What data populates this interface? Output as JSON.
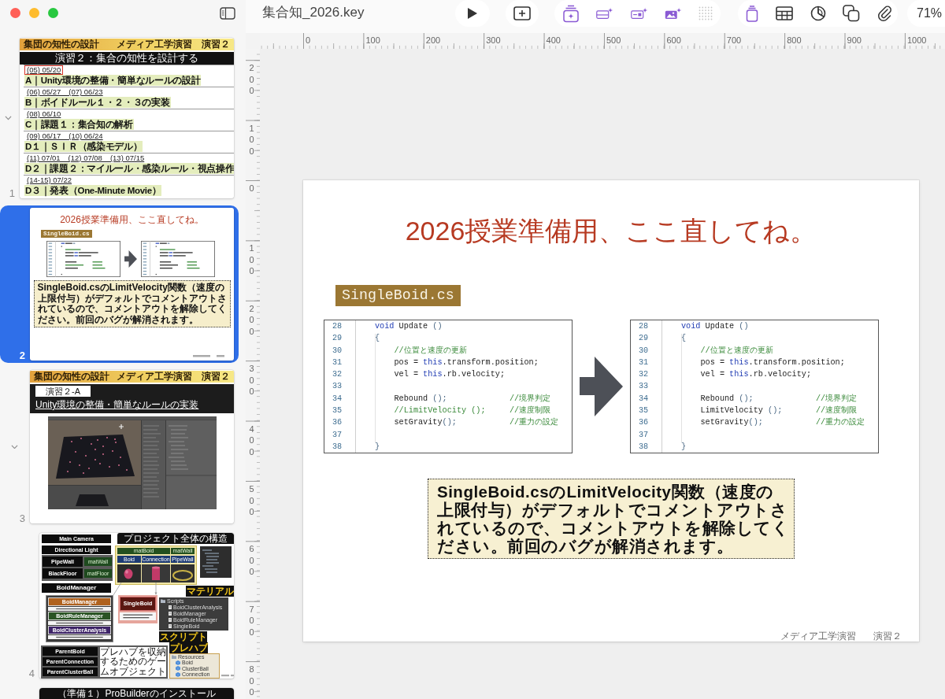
{
  "window": {
    "title": "集合知_2026.key"
  },
  "toolbar": {
    "zoom": "71%"
  },
  "navigator": {
    "slides": [
      {
        "number": "1",
        "kind": "agenda",
        "selected": false,
        "expanded": true,
        "header": {
          "left": "集団の知性の設計",
          "right": "メディア工学演習　演習２"
        },
        "title": "演習２：集合の知性を設計する",
        "units": [
          {
            "dates": "(05) 05/20",
            "marked": true,
            "title": "A｜Unity環境の整備・簡単なルールの設計"
          },
          {
            "dates": "(06) 05/27　(07) 06/23",
            "marked": false,
            "title": "B｜ボイドルール１・２・３の実装"
          },
          {
            "dates": "(08) 06/10",
            "marked": false,
            "title": "C｜課題１：集合知の解析"
          },
          {
            "dates": "(09) 06/17　(10) 06/24",
            "marked": false,
            "title": "D１｜ＳＩＲ（感染モデル）"
          },
          {
            "dates": "(11) 07/01　(12) 07/08　(13) 07/15",
            "marked": false,
            "title": "D２｜課題２：マイルール・感染ルール・視点操作"
          },
          {
            "dates": "(14-15) 07/22",
            "marked": false,
            "title": "D３｜発表（One-Minute Movie）"
          }
        ],
        "children": [
          {
            "number": "2",
            "kind": "code_fix",
            "selected": true,
            "title": "2026授業準備用、ここ直してね。",
            "file_label": "SingleBoid.cs",
            "note": "SingleBoid.csのLimitVelocity関数（速度の上限付与）がデフォルトでコメントアウトされているので、コメントアウトを解除してください。前回のバグが解消されます。"
          },
          {
            "number": "3",
            "kind": "section",
            "selected": false,
            "expanded": true,
            "header": {
              "left": "集団の知性の設計",
              "right": "メディア工学演習　演習２"
            },
            "label": "演習２-A",
            "title": "Unity環境の整備・簡単なルールの実装",
            "children": [
              {
                "number": "4",
                "kind": "diagram",
                "selected": false,
                "title": "プロジェクト全体の構造",
                "scene_objects": [
                  "Main Camera",
                  "Directional Light"
                ],
                "walls": [
                  {
                    "object": "PipeWall",
                    "material": "matWall"
                  },
                  {
                    "object": "BlackFloor",
                    "material": "matFloor"
                  }
                ],
                "manager": "BoidManager",
                "materials": {
                  "names": [
                    "matBoid",
                    "matWall"
                  ],
                  "prefabs": [
                    "Boid",
                    "Connection",
                    "PipeWall"
                  ],
                  "label": "マテリアル"
                },
                "classes": [
                  {
                    "name": "BoidManager",
                    "color": "#b0621e"
                  },
                  {
                    "name": "BoidRuleManager",
                    "color": "#2a5424"
                  },
                  {
                    "name": "BoidClusterAnalysis",
                    "color": "#3e2468"
                  }
                ],
                "single_class": "SingleBoid",
                "scripts": {
                  "folder": "Scripts",
                  "files": [
                    "BoidClusterAnalysis",
                    "BoidManager",
                    "BoidRuleManager",
                    "SingleBoid"
                  ],
                  "label": "スクリプト"
                },
                "prefabs": {
                  "label": "プレハブ",
                  "folder": "Resources",
                  "items": [
                    "Boid",
                    "ClusterBall",
                    "Connection"
                  ]
                },
                "parents": [
                  "ParentBoid",
                  "ParentConnection",
                  "ParentClusterBall"
                ],
                "parents_note": "プレハブを収納するためのゲームオブジェクト"
              },
              {
                "kind": "title_bar",
                "selected": false,
                "title": "（準備１）ProBuilderのインストール"
              }
            ]
          }
        ]
      }
    ]
  },
  "rulers": {
    "horizontal": [
      "0",
      "100",
      "200",
      "300",
      "400",
      "500",
      "600",
      "700",
      "800",
      "900",
      "1000"
    ],
    "vertical": [
      "200",
      "100",
      "0",
      "100",
      "200",
      "300",
      "400",
      "500",
      "600",
      "700",
      "800"
    ]
  },
  "slide": {
    "title": "2026授業準備用、ここ直してね。",
    "file_label": "SingleBoid.cs",
    "code_before": [
      {
        "number": "28",
        "tokens": [
          {
            "kind": "keyword",
            "text": "    void"
          },
          {
            "kind": "plain",
            "text": " Update "
          },
          {
            "kind": "punct",
            "text": "()"
          }
        ]
      },
      {
        "number": "29",
        "tokens": [
          {
            "kind": "punct",
            "text": "    {"
          }
        ]
      },
      {
        "number": "30",
        "tokens": [
          {
            "kind": "comment",
            "text": "        //位置と速度の更新"
          }
        ]
      },
      {
        "number": "31",
        "tokens": [
          {
            "kind": "plain",
            "text": "        pos = "
          },
          {
            "kind": "keyword",
            "text": "this"
          },
          {
            "kind": "plain",
            "text": ".transform.position;"
          }
        ]
      },
      {
        "number": "32",
        "tokens": [
          {
            "kind": "plain",
            "text": "        vel = "
          },
          {
            "kind": "keyword",
            "text": "this"
          },
          {
            "kind": "plain",
            "text": ".rb.velocity;"
          }
        ]
      },
      {
        "number": "33"
      },
      {
        "number": "34",
        "tokens": [
          {
            "kind": "plain",
            "text": "        Rebound "
          },
          {
            "kind": "punct",
            "text": "();"
          }
        ],
        "comment": "//境界判定"
      },
      {
        "number": "35",
        "tokens": [
          {
            "kind": "comment",
            "text": "        //LimitVelocity ();"
          }
        ],
        "comment": "//速度制限"
      },
      {
        "number": "36",
        "tokens": [
          {
            "kind": "plain",
            "text": "        setGravity"
          },
          {
            "kind": "punct",
            "text": "();"
          }
        ],
        "comment": "//重力の設定"
      },
      {
        "number": "37"
      },
      {
        "number": "38",
        "tokens": [
          {
            "kind": "punct",
            "text": "    }"
          }
        ]
      }
    ],
    "code_after": [
      {
        "number": "28",
        "tokens": [
          {
            "kind": "keyword",
            "text": "    void"
          },
          {
            "kind": "plain",
            "text": " Update "
          },
          {
            "kind": "punct",
            "text": "()"
          }
        ]
      },
      {
        "number": "29",
        "tokens": [
          {
            "kind": "punct",
            "text": "    {"
          }
        ]
      },
      {
        "number": "30",
        "tokens": [
          {
            "kind": "comment",
            "text": "        //位置と速度の更新"
          }
        ]
      },
      {
        "number": "31",
        "tokens": [
          {
            "kind": "plain",
            "text": "        pos = "
          },
          {
            "kind": "keyword",
            "text": "this"
          },
          {
            "kind": "plain",
            "text": ".transform.position;"
          }
        ]
      },
      {
        "number": "32",
        "tokens": [
          {
            "kind": "plain",
            "text": "        vel = "
          },
          {
            "kind": "keyword",
            "text": "this"
          },
          {
            "kind": "plain",
            "text": ".rb.velocity;"
          }
        ]
      },
      {
        "number": "33"
      },
      {
        "number": "34",
        "tokens": [
          {
            "kind": "plain",
            "text": "        Rebound "
          },
          {
            "kind": "punct",
            "text": "();"
          }
        ],
        "comment": "//境界判定"
      },
      {
        "number": "35",
        "tokens": [
          {
            "kind": "plain",
            "text": "        LimitVelocity "
          },
          {
            "kind": "punct",
            "text": "();"
          }
        ],
        "comment": "//速度制限"
      },
      {
        "number": "36",
        "tokens": [
          {
            "kind": "plain",
            "text": "        setGravity"
          },
          {
            "kind": "punct",
            "text": "();"
          }
        ],
        "comment": "//重力の設定"
      },
      {
        "number": "37"
      },
      {
        "number": "38",
        "tokens": [
          {
            "kind": "punct",
            "text": "    }"
          }
        ]
      }
    ],
    "note": "SingleBoid.csのLimitVelocity関数（速度の上限付与）がデフォルトでコメントアウトされているので、コメントアウトを解除してください。前回のバグが解消されます。",
    "footer": [
      "メディア工学演習",
      "演習２"
    ]
  }
}
